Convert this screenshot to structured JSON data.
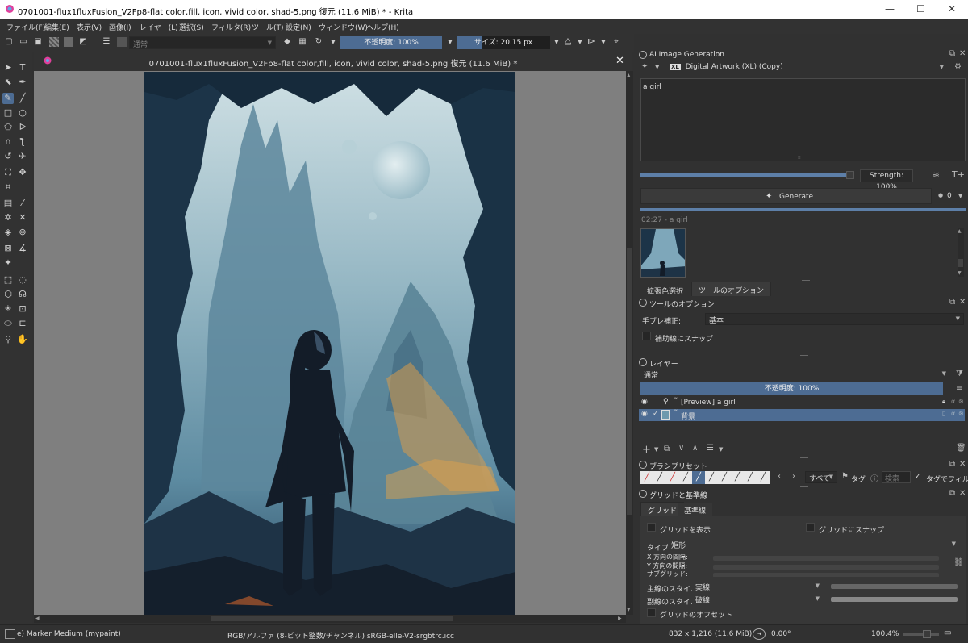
{
  "window": {
    "title": "0701001-flux1fluxFusion_V2Fp8-flat color,fill, icon, vivid color, shad-5.png 復元 (11.6 MiB) * - Krita",
    "minimize": "—",
    "maximize": "☐",
    "close": "✕"
  },
  "menu": [
    "ファイル(F)",
    "編集(E)",
    "表示(V)",
    "画像(I)",
    "レイヤー(L)",
    "選択(S)",
    "フィルタ(R)",
    "ツール(T)",
    "設定(N)",
    "ウィンドウ(W)",
    "ヘルプ(H)"
  ],
  "toolbar": {
    "blend_mode": "通常",
    "opacity_label": "不透明度: 100%",
    "opacity_value": 100,
    "size_label": "サイズ: 20.15 px",
    "size_fraction": 0.28
  },
  "document": {
    "tab_title": "0701001-flux1fluxFusion_V2Fp8-flat color,fill, icon, vivid color, shad-5.png 復元 (11.6 MiB) *",
    "close": "✕"
  },
  "ai_panel": {
    "title": "AI Image Generation",
    "model": "Digital Artwork (XL) (Copy)",
    "model_badge": "XL",
    "prompt": "a girl",
    "strength_label": "Strength: 100%",
    "strength_value": 100,
    "generate_label": "Generate",
    "queue_count": "0",
    "history_label": "02:27 - a girl"
  },
  "dock_tabs": [
    "拡張色選択",
    "ツールのオプション"
  ],
  "tool_options": {
    "title": "ツールのオプション",
    "smoothing_label": "手ブレ補正:",
    "smoothing_value": "基本",
    "snap_label": "補助線にスナップ"
  },
  "layers": {
    "title": "レイヤー",
    "blend_mode": "通常",
    "opacity_label": "不透明度: 100%",
    "opacity_value": 100,
    "items": [
      {
        "name": "[Preview] a girl",
        "selected": false
      },
      {
        "name": "背景",
        "selected": true
      }
    ]
  },
  "brush_presets": {
    "title": "ブラシプリセット",
    "filter_all": "すべて",
    "tag_label": "タグ",
    "search_placeholder": "検索",
    "filter_by_tag": "タグでフィルタ"
  },
  "grid_panel": {
    "title": "グリッドと基準線",
    "tabs": [
      "グリッド",
      "基準線"
    ],
    "show_grid": "グリッドを表示",
    "snap_grid": "グリッドにスナップ",
    "type_label": "タイプ:",
    "type_value": "矩形",
    "x_spacing": "X 方向の間隔:",
    "y_spacing": "Y 方向の間隔:",
    "subdivision": "サブグリッド:",
    "main_style_label": "主線のスタイル:",
    "main_style_value": "実線",
    "sub_style_label": "副線のスタイル:",
    "sub_style_value": "破線",
    "offset_label": "グリッドのオフセット"
  },
  "status": {
    "brush": "e) Marker Medium (mypaint)",
    "color_space": "RGB/アルファ (8-ビット整数/チャンネル)  sRGB-elle-V2-srgbtrc.icc",
    "dimensions": "832 x 1,216 (11.6 MiB)",
    "rotation": "0.00°",
    "zoom": "100.4%"
  },
  "colors": {
    "accent": "#4d6c93",
    "panel_bg": "#313131",
    "canvas_bg": "#7f7f7f"
  }
}
